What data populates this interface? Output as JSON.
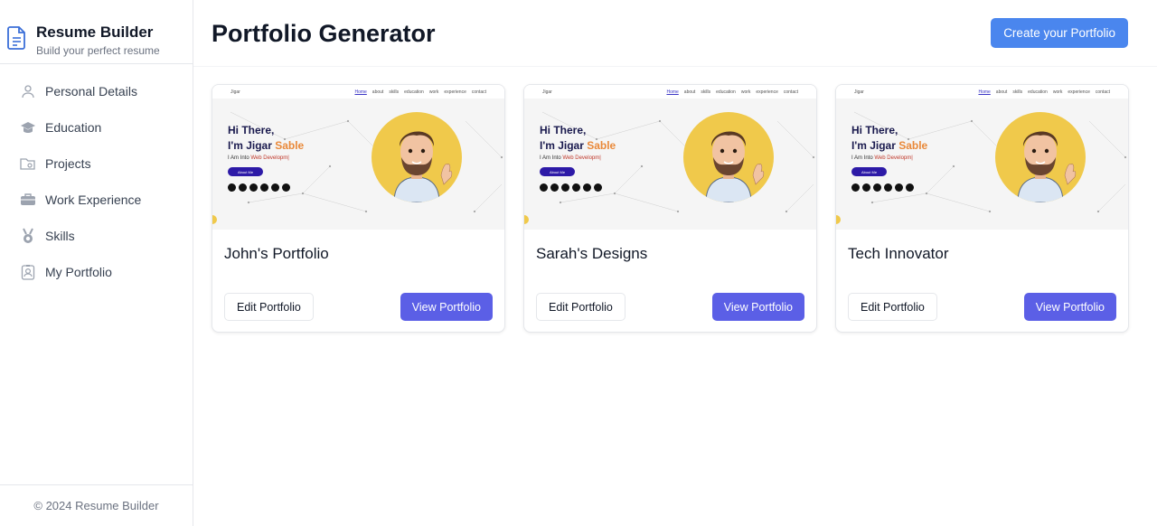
{
  "sidebar": {
    "brand": {
      "title": "Resume Builder",
      "subtitle": "Build your perfect resume",
      "icon": "document-icon"
    },
    "items": [
      {
        "label": "Personal Details",
        "icon": "user-icon"
      },
      {
        "label": "Education",
        "icon": "graduation-cap-icon"
      },
      {
        "label": "Projects",
        "icon": "folder-icon"
      },
      {
        "label": "Work Experience",
        "icon": "briefcase-icon"
      },
      {
        "label": "Skills",
        "icon": "medal-icon"
      },
      {
        "label": "My Portfolio",
        "icon": "id-badge-icon"
      }
    ],
    "footer": "© 2024 Resume Builder"
  },
  "header": {
    "title": "Portfolio Generator",
    "create_button": "Create your Portfolio"
  },
  "preview": {
    "nav_links": [
      "Home",
      "about",
      "skills",
      "education",
      "work",
      "experience",
      "contact"
    ],
    "greeting": "Hi There,",
    "name_prefix": "I'm Jigar ",
    "name_accent": "Sable",
    "tagline_prefix": "I Am Into ",
    "tagline_accent": "Web Developm|",
    "about_button": "About Me",
    "brand": "Jigar"
  },
  "cards": [
    {
      "title": "John's Portfolio",
      "edit_label": "Edit Portfolio",
      "view_label": "View Portfolio"
    },
    {
      "title": "Sarah's Designs",
      "edit_label": "Edit Portfolio",
      "view_label": "View Portfolio"
    },
    {
      "title": "Tech Innovator",
      "edit_label": "Edit Portfolio",
      "view_label": "View Portfolio"
    }
  ],
  "colors": {
    "primary_button": "#4a86ee",
    "view_button": "#5b5fe6",
    "accent_orange": "#e9893a",
    "avatar_bg": "#f0c94b"
  }
}
